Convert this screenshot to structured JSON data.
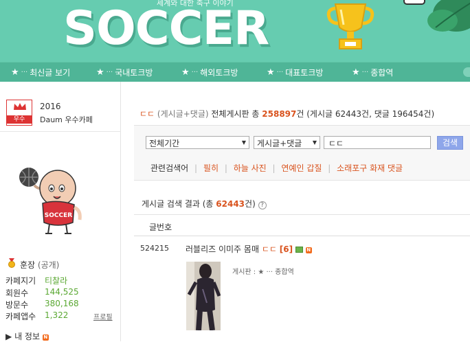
{
  "banner": {
    "subtitle": "세계와 대한 축구 이야기",
    "logo_text": "SOCCER",
    "colors": {
      "background": "#66ccb0",
      "nav": "#4fb597"
    }
  },
  "nav": {
    "items": [
      {
        "star": "★",
        "dots": "···",
        "label": "최신글 보기"
      },
      {
        "star": "★",
        "dots": "···",
        "label": "국내토크방"
      },
      {
        "star": "★",
        "dots": "···",
        "label": "해외토크방"
      },
      {
        "star": "★",
        "dots": "···",
        "label": "대표토크방"
      },
      {
        "star": "★",
        "dots": "···",
        "label": "종합역"
      }
    ]
  },
  "sidebar": {
    "grade_label": "우수",
    "year": "2016",
    "daum_label": "Daum 우수카페",
    "mascot_label": "SOCCER",
    "rank": "훈장",
    "rank_public": "(공개)",
    "stats": [
      {
        "label": "카페지기",
        "value": "티찰라"
      },
      {
        "label": "회원수",
        "value": "144,525"
      },
      {
        "label": "방문수",
        "value": "380,168"
      },
      {
        "label": "카페앱수",
        "value": "1,322"
      }
    ],
    "profile_link": "프로필",
    "my_info": "내 정보",
    "new_badge": "N"
  },
  "summary": {
    "query": "ㄷㄷ",
    "scope": "(게시글+댓글)",
    "board": "전체게시판 총",
    "total": "258897",
    "unit": "건",
    "detail": "(게시글 62443건, 댓글 196454건)"
  },
  "search": {
    "period": "전체기간",
    "scope": "게시글+댓글",
    "query": "ㄷㄷ",
    "button": "검색",
    "related_label": "관련검색어",
    "related": [
      "필히",
      "하늘 사진",
      "연예인 갑질",
      "소래포구 화재 댓글"
    ]
  },
  "results": {
    "title_prefix": "게시글 검색 결과 (총",
    "count": "62443",
    "title_suffix": "건)",
    "help": "?",
    "column": "글번호",
    "items": [
      {
        "num": "524215",
        "title": "러블리즈 이미주 몸매",
        "query": "ㄷㄷ",
        "comments": "[6]",
        "new": "N",
        "board": "게시판 : ★ ··· 종합역"
      }
    ]
  }
}
